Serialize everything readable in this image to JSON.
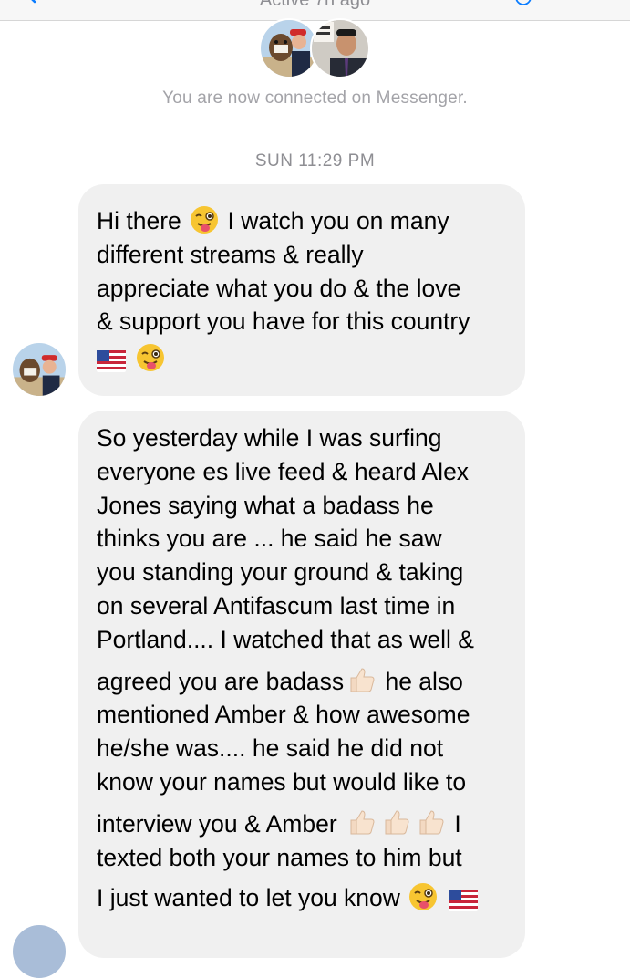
{
  "header": {
    "status_text": "Active 7h ago",
    "back_icon": "chevron-left-icon",
    "info_icon": "info-icon",
    "accent": "#0a7cff"
  },
  "intro": {
    "connected_text": "You are now connected on Messenger."
  },
  "timestamp": "SUN 11:29 PM",
  "messages": [
    {
      "lines": [
        "Hi there",
        "I watch you on many",
        "different streams & really",
        "appreciate what you do & the love",
        "& support you have for this country"
      ]
    },
    {
      "lines": [
        "So yesterday while I was surfing",
        "everyone es live feed & heard Alex",
        "Jones saying what a badass he",
        "thinks you are ... he said he saw",
        "you standing your ground & taking",
        "on several Antifascum last time in",
        "Portland.... I watched that as well &",
        "agreed you are badass",
        "he also",
        "mentioned Amber & how awesome",
        "he/she was.... he said he did not",
        "know your names but would like to",
        "interview you & Amber",
        "I",
        "texted both your names to him but",
        "I just wanted to let you know"
      ]
    }
  ],
  "colors": {
    "bubble_bg": "#f0f0f0",
    "meta_text": "#8e8e93"
  }
}
